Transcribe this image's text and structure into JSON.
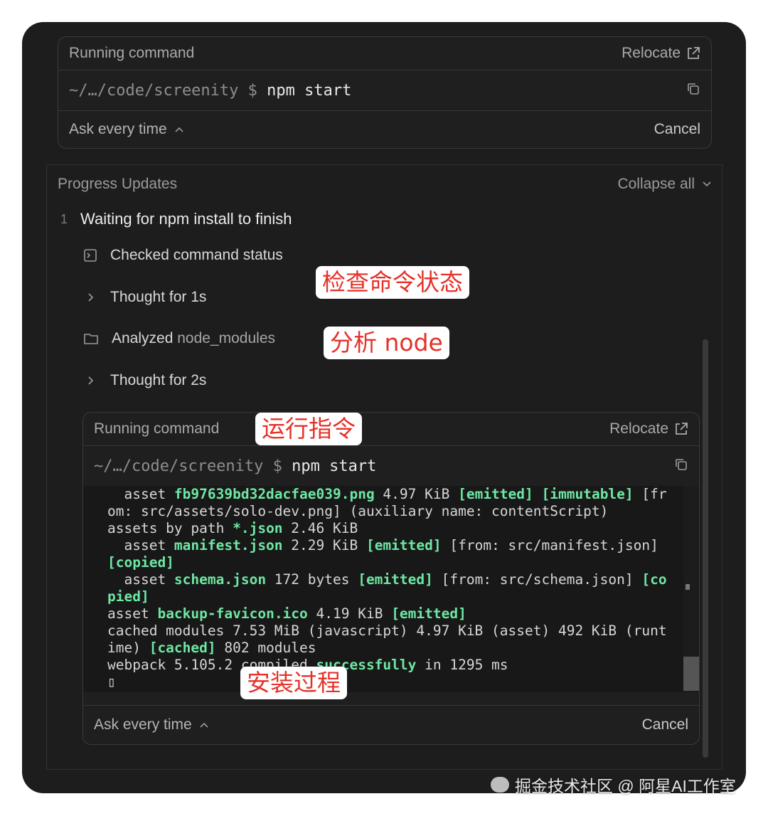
{
  "top_card": {
    "title": "Running command",
    "relocate_label": "Relocate",
    "prompt_path": "~/…/code/screenity $ ",
    "command": "npm start",
    "ask_label": "Ask every time",
    "cancel_label": "Cancel"
  },
  "progress": {
    "title": "Progress Updates",
    "collapse_label": "Collapse all",
    "step_number": "1",
    "step_title": "Waiting for npm install to finish",
    "items": [
      {
        "label": "Checked command status",
        "muted": ""
      },
      {
        "label": "Thought for 1s",
        "muted": ""
      },
      {
        "label": "Analyzed ",
        "muted": "node_modules"
      },
      {
        "label": "Thought for 2s",
        "muted": ""
      }
    ]
  },
  "inner_card": {
    "title": "Running command",
    "relocate_label": "Relocate",
    "prompt_path": "~/…/code/screenity $ ",
    "command": "npm start",
    "ask_label": "Ask every time",
    "cancel_label": "Cancel",
    "terminal_lines": [
      [
        {
          "t": "  asset "
        },
        {
          "t": "fb97639bd32dacfae039.png",
          "g": true
        },
        {
          "t": " 4.97 KiB "
        },
        {
          "t": "[emitted]",
          "g": true
        },
        {
          "t": " "
        },
        {
          "t": "[immutable]",
          "g": true
        },
        {
          "t": " [fr"
        }
      ],
      [
        {
          "t": "om: src/assets/solo-dev.png] (auxiliary name: contentScript)"
        }
      ],
      [
        {
          "t": "assets by path "
        },
        {
          "t": "*.json",
          "g": true
        },
        {
          "t": " 2.46 KiB"
        }
      ],
      [
        {
          "t": "  asset "
        },
        {
          "t": "manifest.json",
          "g": true
        },
        {
          "t": " 2.29 KiB "
        },
        {
          "t": "[emitted]",
          "g": true
        },
        {
          "t": " [from: src/manifest.json]"
        }
      ],
      [
        {
          "t": "[copied]",
          "g": true
        }
      ],
      [
        {
          "t": "  asset "
        },
        {
          "t": "schema.json",
          "g": true
        },
        {
          "t": " 172 bytes "
        },
        {
          "t": "[emitted]",
          "g": true
        },
        {
          "t": " [from: src/schema.json] "
        },
        {
          "t": "[co",
          "g": true
        }
      ],
      [
        {
          "t": "pied]",
          "g": true
        }
      ],
      [
        {
          "t": "asset "
        },
        {
          "t": "backup-favicon.ico",
          "g": true
        },
        {
          "t": " 4.19 KiB "
        },
        {
          "t": "[emitted]",
          "g": true
        }
      ],
      [
        {
          "t": "cached modules 7.53 MiB (javascript) 4.97 KiB (asset) 492 KiB (runt"
        }
      ],
      [
        {
          "t": "ime) "
        },
        {
          "t": "[cached]",
          "g": true
        },
        {
          "t": " 802 modules"
        }
      ],
      [
        {
          "t": "webpack 5.105.2 compiled "
        },
        {
          "t": "successfully",
          "g": true
        },
        {
          "t": " in 1295 ms"
        }
      ],
      [
        {
          "t": "▯"
        }
      ]
    ]
  },
  "annotations": {
    "check_status": "检查命令状态",
    "analyze_node": "分析 node",
    "run_command": "运行指令",
    "install_process": "安装过程"
  },
  "watermark": "掘金技术社区 @ 阿星AI工作室",
  "icons": {
    "relocate": "external-link-icon",
    "copy": "copy-icon",
    "chevron_up": "chevron-up-icon",
    "chevron_down": "chevron-down-icon",
    "chevron_right": "chevron-right-icon",
    "terminal": "terminal-icon",
    "folder": "folder-icon"
  },
  "colors": {
    "background": "#1d1d1d",
    "emitted_green": "#6ee7a3",
    "annotation_red": "#e5322b"
  }
}
